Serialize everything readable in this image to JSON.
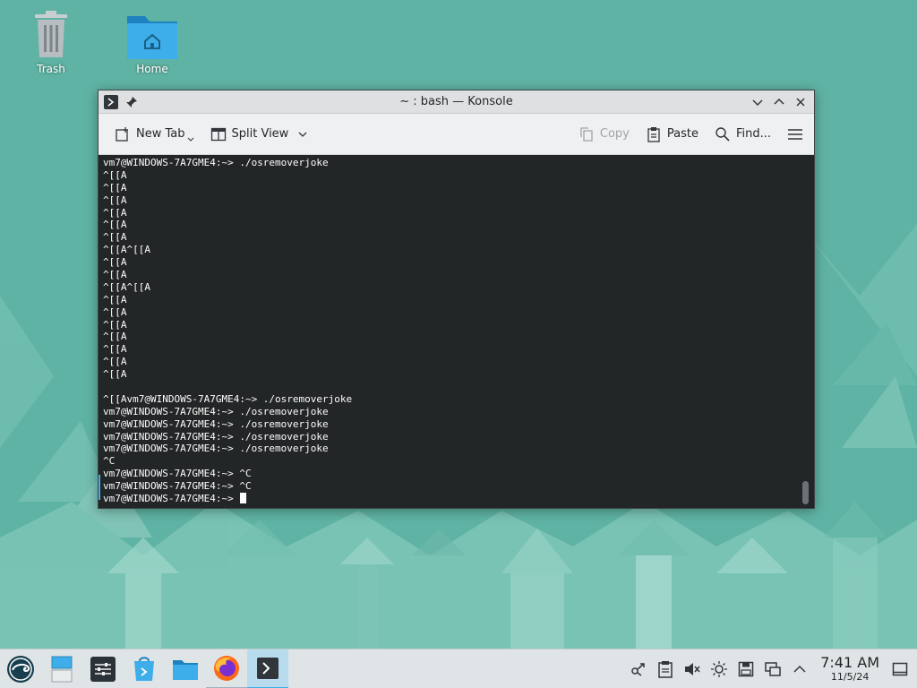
{
  "desktop": {
    "icons": [
      {
        "label": "Trash"
      },
      {
        "label": "Home"
      }
    ]
  },
  "window": {
    "title": "~ : bash — Konsole",
    "toolbar": {
      "new_tab": "New Tab",
      "split_view": "Split View",
      "copy": "Copy",
      "paste": "Paste",
      "find": "Find..."
    }
  },
  "terminal": {
    "lines": [
      "vm7@WINDOWS-7A7GME4:~> ./osremoverjoke",
      "^[[A",
      "^[[A",
      "^[[A",
      "^[[A",
      "^[[A",
      "^[[A",
      "^[[A^[[A",
      "^[[A",
      "^[[A",
      "^[[A^[[A",
      "^[[A",
      "^[[A",
      "^[[A",
      "^[[A",
      "^[[A",
      "^[[A",
      "^[[A",
      "",
      "^[[Avm7@WINDOWS-7A7GME4:~> ./osremoverjoke",
      "vm7@WINDOWS-7A7GME4:~> ./osremoverjoke",
      "vm7@WINDOWS-7A7GME4:~> ./osremoverjoke",
      "vm7@WINDOWS-7A7GME4:~> ./osremoverjoke",
      "vm7@WINDOWS-7A7GME4:~> ./osremoverjoke",
      "^C",
      "vm7@WINDOWS-7A7GME4:~> ^C",
      "vm7@WINDOWS-7A7GME4:~> ^C"
    ],
    "prompt": "vm7@WINDOWS-7A7GME4:~> "
  },
  "taskbar": {
    "apps": [
      {
        "icon": "opensuse-launcher-icon"
      },
      {
        "icon": "desktop-pager-icon"
      },
      {
        "icon": "system-settings-icon"
      },
      {
        "icon": "discover-icon"
      },
      {
        "icon": "dolphin-files-icon"
      },
      {
        "icon": "firefox-icon"
      },
      {
        "icon": "konsole-icon"
      }
    ],
    "clock": {
      "time": "7:41 AM",
      "date": "11/5/24"
    }
  },
  "colors": {
    "accent": "#3daee9",
    "terminal_bg": "#232627",
    "terminal_fg": "#fcfcfc",
    "wallpaper": "#5fb3a4"
  }
}
